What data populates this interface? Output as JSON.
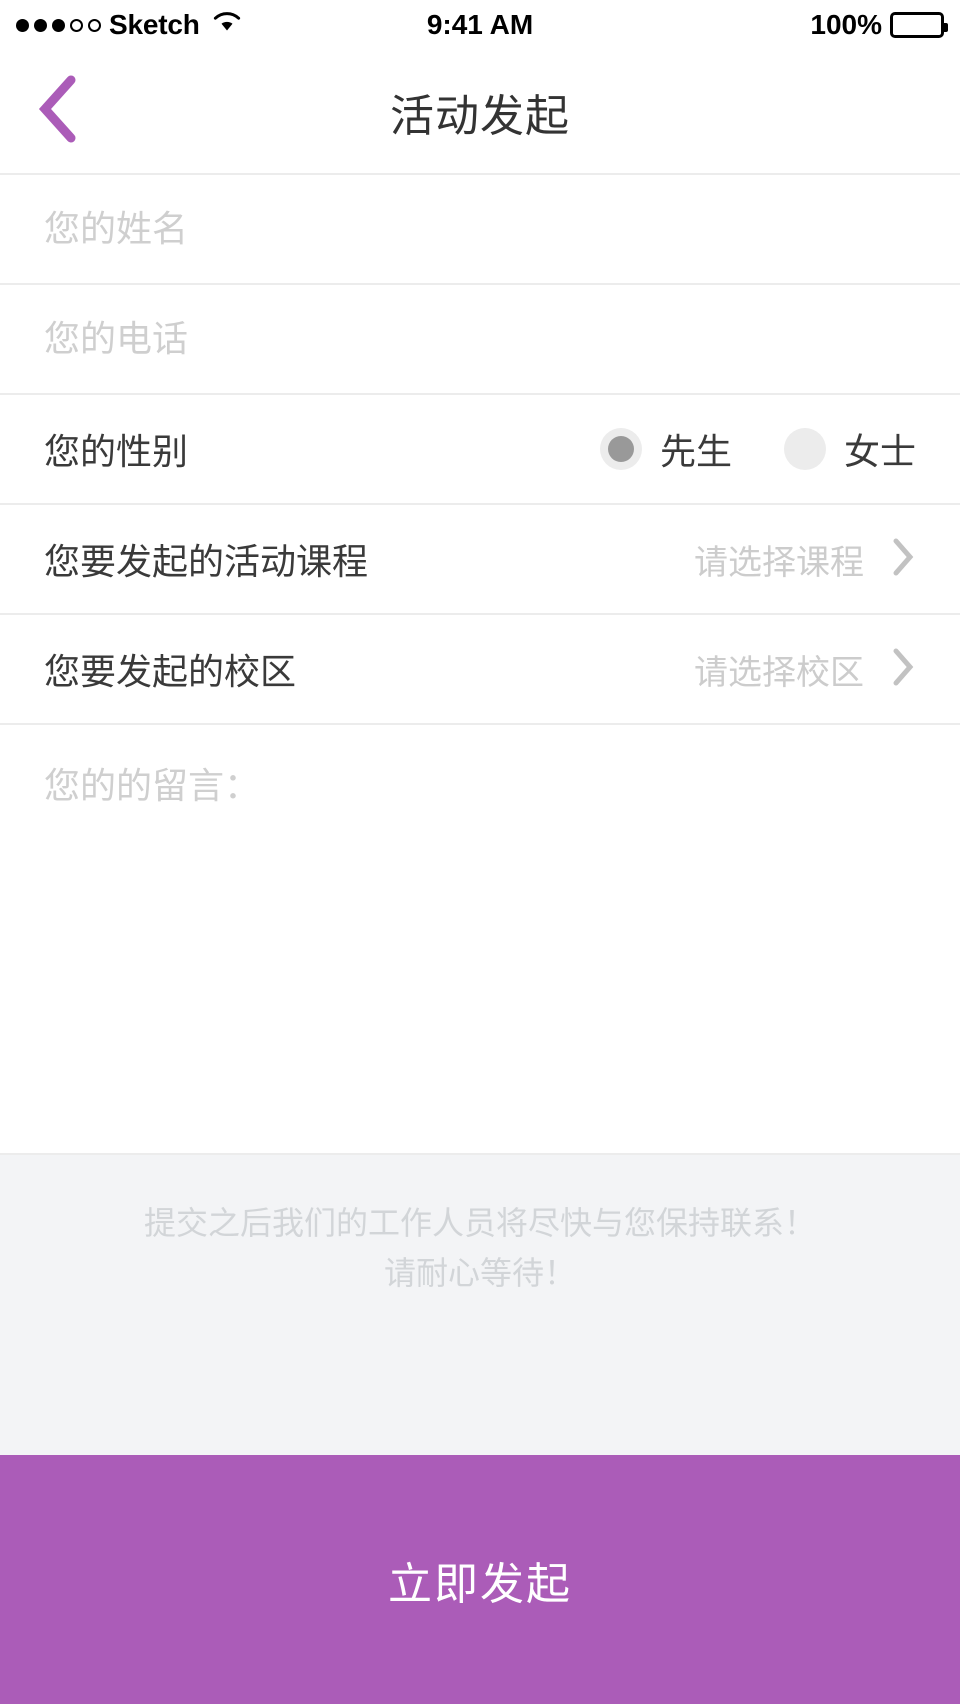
{
  "status_bar": {
    "signal_dots_filled": 3,
    "signal_dots_total": 5,
    "carrier": "Sketch",
    "wifi_icon": "wifi-icon",
    "time": "9:41 AM",
    "battery_percent": "100%",
    "battery_icon": "battery-full-icon"
  },
  "navbar": {
    "back_icon": "chevron-left-icon",
    "title": "活动发起",
    "accent_color": "#ab5cb8"
  },
  "form": {
    "name": {
      "placeholder": "您的姓名",
      "value": ""
    },
    "phone": {
      "placeholder": "您的电话",
      "value": ""
    },
    "gender": {
      "label": "您的性别",
      "options": [
        {
          "label": "先生",
          "selected": true
        },
        {
          "label": "女士",
          "selected": false
        }
      ]
    },
    "course": {
      "label": "您要发起的活动课程",
      "value": "请选择课程",
      "chevron_icon": "chevron-right-icon"
    },
    "campus": {
      "label": "您要发起的校区",
      "value": "请选择校区",
      "chevron_icon": "chevron-right-icon"
    },
    "message": {
      "placeholder": "您的的留言：",
      "value": ""
    }
  },
  "note": {
    "line1": "提交之后我们的工作人员将尽快与您保持联系！",
    "line2": "请耐心等待！"
  },
  "submit": {
    "label": "立即发起",
    "background": "#ab5cb8"
  }
}
